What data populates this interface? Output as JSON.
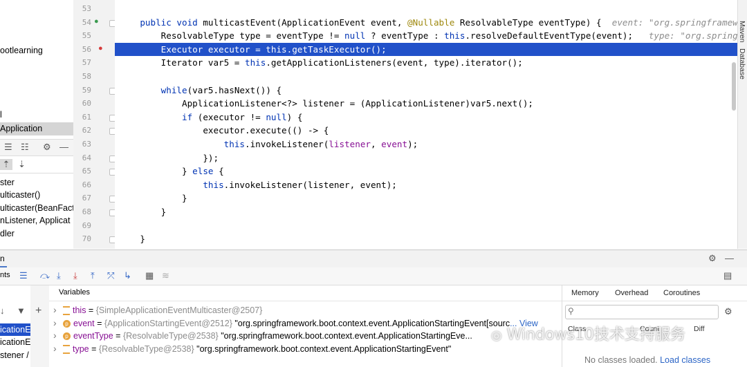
{
  "project_panel": {
    "items": [
      "ootlearning",
      "l",
      "Application"
    ],
    "frames": [
      "ster",
      "ulticaster()",
      "ulticaster(BeanFactor",
      "nListener, Applicat",
      "dler"
    ]
  },
  "gutter": {
    "line_numbers": [
      "53",
      "54",
      "55",
      "56",
      "57",
      "58",
      "59",
      "60",
      "61",
      "62",
      "63",
      "64",
      "65",
      "66",
      "67",
      "68",
      "69",
      "70"
    ]
  },
  "editor": {
    "lines": [
      {
        "t": []
      },
      {
        "t": [
          [
            "    ",
            ""
          ],
          [
            "public void ",
            "kw"
          ],
          [
            "multicastEvent(ApplicationEvent event, ",
            ""
          ],
          [
            "@Nullable ",
            "ann"
          ],
          [
            "ResolvableType eventType) {  ",
            ""
          ],
          [
            "event: \"org.springframewor",
            "hint"
          ]
        ]
      },
      {
        "t": [
          [
            "        ResolvableType type = eventType != ",
            ""
          ],
          [
            "null",
            "kw"
          ],
          [
            " ? eventType : ",
            ""
          ],
          [
            "this",
            "kw"
          ],
          [
            ".resolveDefaultEventType(event);   ",
            ""
          ],
          [
            "type: \"org.springfra",
            "hint"
          ]
        ]
      },
      {
        "t": [
          [
            "        Executor executor = this.getTaskExecutor();",
            ""
          ]
        ],
        "hl": true
      },
      {
        "t": [
          [
            "        Iterator var5 = ",
            ""
          ],
          [
            "this",
            "kw"
          ],
          [
            ".getApplicationListeners(event, type).iterator();",
            ""
          ]
        ]
      },
      {
        "t": []
      },
      {
        "t": [
          [
            "        ",
            ""
          ],
          [
            "while",
            "kw"
          ],
          [
            "(var5.hasNext()) {",
            ""
          ]
        ]
      },
      {
        "t": [
          [
            "            ApplicationListener<?> listener = (ApplicationListener)var5.next();",
            ""
          ]
        ]
      },
      {
        "t": [
          [
            "            ",
            ""
          ],
          [
            "if",
            "kw"
          ],
          [
            " (executor != ",
            ""
          ],
          [
            "null",
            "kw"
          ],
          [
            ") {",
            ""
          ]
        ]
      },
      {
        "t": [
          [
            "                executor.execute(() -> {",
            ""
          ]
        ]
      },
      {
        "t": [
          [
            "                    ",
            ""
          ],
          [
            "this",
            "kw"
          ],
          [
            ".invokeListener(",
            ""
          ],
          [
            "listener",
            "pm"
          ],
          [
            ", ",
            ""
          ],
          [
            "event",
            "pm"
          ],
          [
            ");",
            ""
          ]
        ]
      },
      {
        "t": [
          [
            "                });",
            ""
          ]
        ]
      },
      {
        "t": [
          [
            "            } ",
            ""
          ],
          [
            "else",
            "kw"
          ],
          [
            " {",
            ""
          ]
        ]
      },
      {
        "t": [
          [
            "                ",
            ""
          ],
          [
            "this",
            "kw"
          ],
          [
            ".invokeListener(listener, event);",
            ""
          ]
        ]
      },
      {
        "t": [
          [
            "            }",
            ""
          ]
        ]
      },
      {
        "t": [
          [
            "        }",
            ""
          ]
        ]
      },
      {
        "t": []
      },
      {
        "t": [
          [
            "    }",
            ""
          ]
        ]
      }
    ]
  },
  "right_strip": {
    "maven": "Maven",
    "database": "Database"
  },
  "debug": {
    "tab_fragment": "n",
    "toolbar_fragment": "nts",
    "variables_title": "Variables",
    "frames_visible": [
      "icationEve",
      "icationEve",
      "stener /"
    ],
    "variables": [
      {
        "name": "this",
        "eq": " = ",
        "typeinfo": "{SimpleApplicationEventMulticaster@2507}",
        "value": "",
        "kind": "lines"
      },
      {
        "name": "event",
        "eq": " = ",
        "typeinfo": "{ApplicationStartingEvent@2512}",
        "value": " \"org.springframework.boot.context.event.ApplicationStartingEvent[sourc",
        "link": "... View",
        "kind": "p"
      },
      {
        "name": "eventType",
        "eq": " = ",
        "typeinfo": "{ResolvableType@2538}",
        "value": " \"org.springframework.boot.context.event.ApplicationStartingEve...",
        "kind": "p"
      },
      {
        "name": "type",
        "eq": " = ",
        "typeinfo": "{ResolvableType@2538}",
        "value": " \"org.springframework.boot.context.event.ApplicationStartingEvent\"",
        "kind": "lines"
      }
    ],
    "memory_tabs": [
      "Memory",
      "Overhead",
      "Coroutines"
    ],
    "memory_columns": [
      "Class",
      "Count",
      "Diff"
    ],
    "no_classes_text": "No classes loaded.",
    "load_classes": "Load classes",
    "search_placeholder": ""
  },
  "watermark": "Windows10技术支持服务"
}
